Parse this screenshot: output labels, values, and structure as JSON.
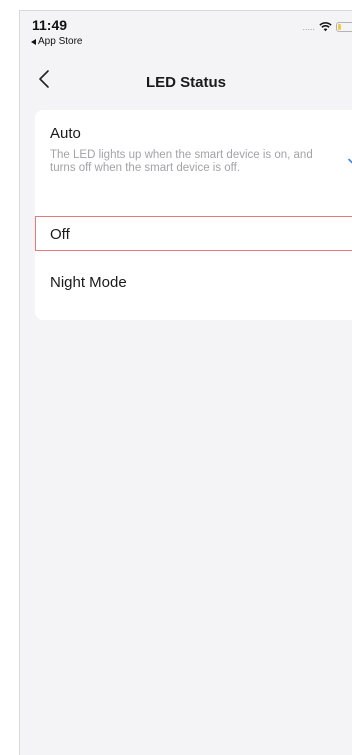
{
  "status_bar": {
    "time": "11:49",
    "back_app": "App Store",
    "signal": "....."
  },
  "nav": {
    "title": "LED Status",
    "back_icon": "chevron-left-icon"
  },
  "options": [
    {
      "label": "Auto",
      "description": "The LED lights up when the smart device is on, and turns off when the smart device is off.",
      "selected": true
    },
    {
      "label": "Off",
      "selected": false
    },
    {
      "label": "Night Mode",
      "selected": false
    }
  ],
  "colors": {
    "accent": "#3b82f6",
    "highlight_border": "#e7787c",
    "background": "#f4f4f6"
  }
}
